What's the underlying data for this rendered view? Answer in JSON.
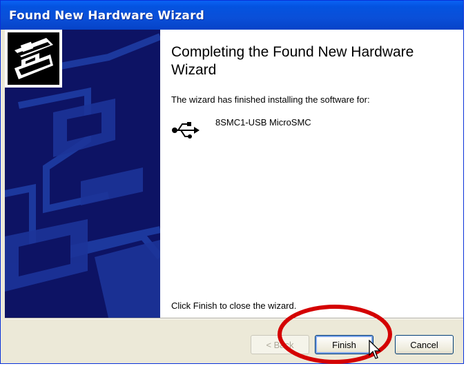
{
  "window": {
    "title": "Found New Hardware Wizard"
  },
  "content": {
    "heading": "Completing the Found New Hardware Wizard",
    "subtext": "The wizard has finished installing the software for:",
    "device_name": "8SMC1-USB MicroSMC",
    "footer_text": "Click Finish to close the wizard."
  },
  "buttons": {
    "back": "< Back",
    "finish": "Finish",
    "cancel": "Cancel"
  },
  "icons": {
    "wizard": "hardware-wizard-icon",
    "usb": "usb-icon",
    "cursor": "mouse-pointer-icon"
  },
  "colors": {
    "titlebar": "#0453e0",
    "side_panel": "#0d1364",
    "annotation": "#d40000"
  }
}
